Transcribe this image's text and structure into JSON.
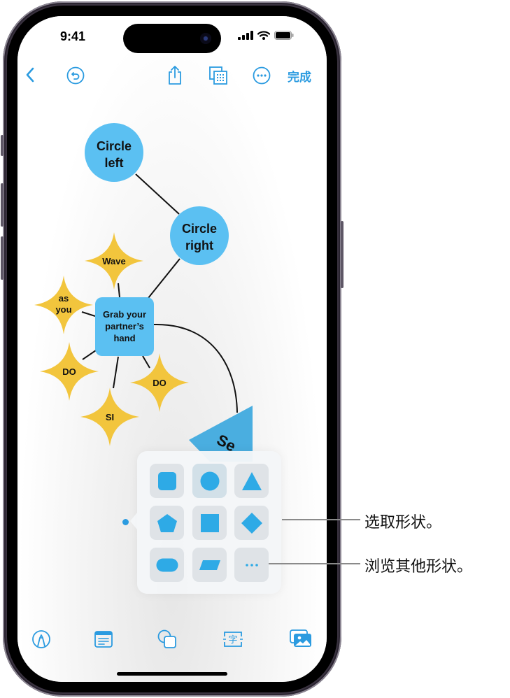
{
  "status_bar": {
    "time": "9:41"
  },
  "top_toolbar": {
    "back_icon": "chevron-left-icon",
    "undo_icon": "undo-icon",
    "share_icon": "share-icon",
    "view_icon": "grid-view-icon",
    "more_icon": "ellipsis-circle-icon",
    "done_label": "完成"
  },
  "canvas": {
    "nodes": [
      {
        "id": "circle-left",
        "shape": "circle",
        "lines": [
          "Circle",
          "left"
        ]
      },
      {
        "id": "circle-right",
        "shape": "circle",
        "lines": [
          "Circle",
          "right"
        ]
      },
      {
        "id": "wave",
        "shape": "star",
        "lines": [
          "Wave"
        ]
      },
      {
        "id": "as-you",
        "shape": "star",
        "lines": [
          "as",
          "you"
        ]
      },
      {
        "id": "grab",
        "shape": "rounded-square",
        "lines": [
          "Grab your",
          "partner’s",
          "hand"
        ]
      },
      {
        "id": "do-left",
        "shape": "star",
        "lines": [
          "DO"
        ]
      },
      {
        "id": "do-right",
        "shape": "star",
        "lines": [
          "DO"
        ]
      },
      {
        "id": "si",
        "shape": "star",
        "lines": [
          "SI"
        ]
      },
      {
        "id": "see",
        "shape": "triangle",
        "lines": [
          "Se"
        ]
      }
    ],
    "colors": {
      "blue_shape": "#5bc0f2",
      "yellow_shape": "#f2c53d",
      "triangle": "#4aaee0"
    }
  },
  "shape_picker": {
    "items": [
      {
        "name": "rounded-square",
        "label": "Rounded square"
      },
      {
        "name": "circle",
        "label": "Circle"
      },
      {
        "name": "triangle",
        "label": "Triangle"
      },
      {
        "name": "pentagon",
        "label": "Pentagon"
      },
      {
        "name": "square",
        "label": "Square"
      },
      {
        "name": "diamond",
        "label": "Diamond"
      },
      {
        "name": "pill",
        "label": "Pill"
      },
      {
        "name": "parallelogram",
        "label": "Parallelogram"
      },
      {
        "name": "more",
        "label": "···"
      }
    ],
    "accent": "#2eaae6"
  },
  "callouts": {
    "select_shape": "选取形状。",
    "browse_shapes": "浏览其他形状。"
  },
  "bottom_toolbar": {
    "icons": [
      "pen-icon",
      "note-card-icon",
      "shapes-icon",
      "text-box-icon",
      "media-icon"
    ],
    "text_icon_glyph": "字"
  }
}
